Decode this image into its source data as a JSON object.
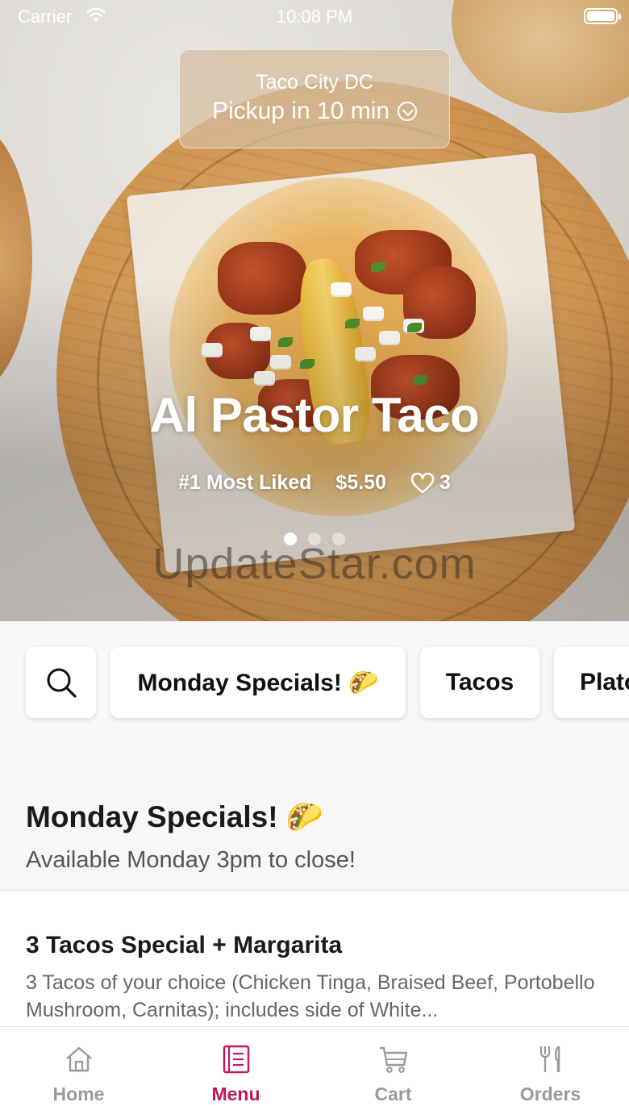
{
  "status_bar": {
    "carrier": "Carrier",
    "time": "10:08 PM"
  },
  "location": {
    "name": "Taco City DC",
    "pickup": "Pickup in 10 min"
  },
  "hero": {
    "title": "Al Pastor Taco",
    "badge": "#1 Most Liked",
    "price": "$5.50",
    "likes": "3",
    "carousel": {
      "count": 3,
      "active": 1
    },
    "watermark": "UpdateStar.com"
  },
  "categories": {
    "search_icon": "search-icon",
    "items": [
      "Monday Specials! 🌮",
      "Tacos",
      "Platos"
    ]
  },
  "section": {
    "title": "Monday Specials! 🌮",
    "subtitle": "Available Monday 3pm to close!"
  },
  "menu_items": [
    {
      "name": "3 Tacos Special + Margarita",
      "description": "3 Tacos of your choice (Chicken Tinga, Braised Beef, Portobello Mushroom, Carnitas); includes side of White..."
    }
  ],
  "tabbar": {
    "active_color": "#c2185b",
    "inactive_color": "#9a9a9a",
    "tabs": [
      {
        "label": "Home",
        "icon": "home-icon"
      },
      {
        "label": "Menu",
        "icon": "menu-icon"
      },
      {
        "label": "Cart",
        "icon": "cart-icon"
      },
      {
        "label": "Orders",
        "icon": "orders-icon"
      }
    ],
    "active": "Menu"
  }
}
